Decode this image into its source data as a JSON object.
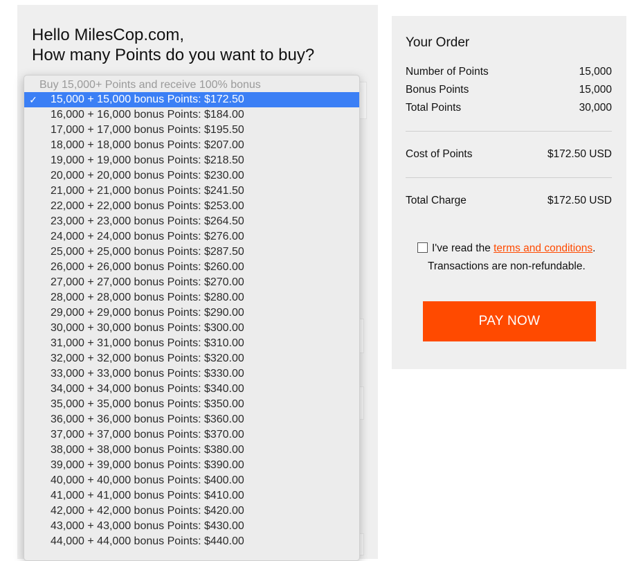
{
  "greeting": {
    "line1": "Hello MilesCop.com,",
    "line2": "How many Points do you want to buy?"
  },
  "dropdown": {
    "header": "Buy 15,000+ Points and receive 100% bonus",
    "check_icon": "✓",
    "items": [
      "15,000 + 15,000 bonus Points: $172.50",
      "16,000 + 16,000 bonus Points: $184.00",
      "17,000 + 17,000 bonus Points: $195.50",
      "18,000 + 18,000 bonus Points: $207.00",
      "19,000 + 19,000 bonus Points: $218.50",
      "20,000 + 20,000 bonus Points: $230.00",
      "21,000 + 21,000 bonus Points: $241.50",
      "22,000 + 22,000 bonus Points: $253.00",
      "23,000 + 23,000 bonus Points: $264.50",
      "24,000 + 24,000 bonus Points: $276.00",
      "25,000 + 25,000 bonus Points: $287.50",
      "26,000 + 26,000 bonus Points: $260.00",
      "27,000 + 27,000 bonus Points: $270.00",
      "28,000 + 28,000 bonus Points: $280.00",
      "29,000 + 29,000 bonus Points: $290.00",
      "30,000 + 30,000 bonus Points: $300.00",
      "31,000 + 31,000 bonus Points: $310.00",
      "32,000 + 32,000 bonus Points: $320.00",
      "33,000 + 33,000 bonus Points: $330.00",
      "34,000 + 34,000 bonus Points: $340.00",
      "35,000 + 35,000 bonus Points: $350.00",
      "36,000 + 36,000 bonus Points: $360.00",
      "37,000 + 37,000 bonus Points: $370.00",
      "38,000 + 38,000 bonus Points: $380.00",
      "39,000 + 39,000 bonus Points: $390.00",
      "40,000 + 40,000 bonus Points: $400.00",
      "41,000 + 41,000 bonus Points: $410.00",
      "42,000 + 42,000 bonus Points: $420.00",
      "43,000 + 43,000 bonus Points: $430.00",
      "44,000 + 44,000 bonus Points: $440.00"
    ],
    "selected_index": 0
  },
  "order": {
    "title": "Your Order",
    "rows": [
      {
        "label": "Number of Points",
        "value": "15,000"
      },
      {
        "label": "Bonus Points",
        "value": "15,000"
      },
      {
        "label": "Total Points",
        "value": "30,000"
      }
    ],
    "cost_label": "Cost of Points",
    "cost_value": "$172.50 USD",
    "total_label": "Total Charge",
    "total_value": "$172.50 USD",
    "terms_prefix": "I've read the ",
    "terms_link": "terms and conditions",
    "terms_suffix": ".",
    "refund_note": "Transactions are non-refundable.",
    "pay_label": "PAY NOW"
  },
  "colors": {
    "accent": "#ff4a00",
    "selection": "#3b7ff5",
    "panel_bg": "#efefef"
  }
}
